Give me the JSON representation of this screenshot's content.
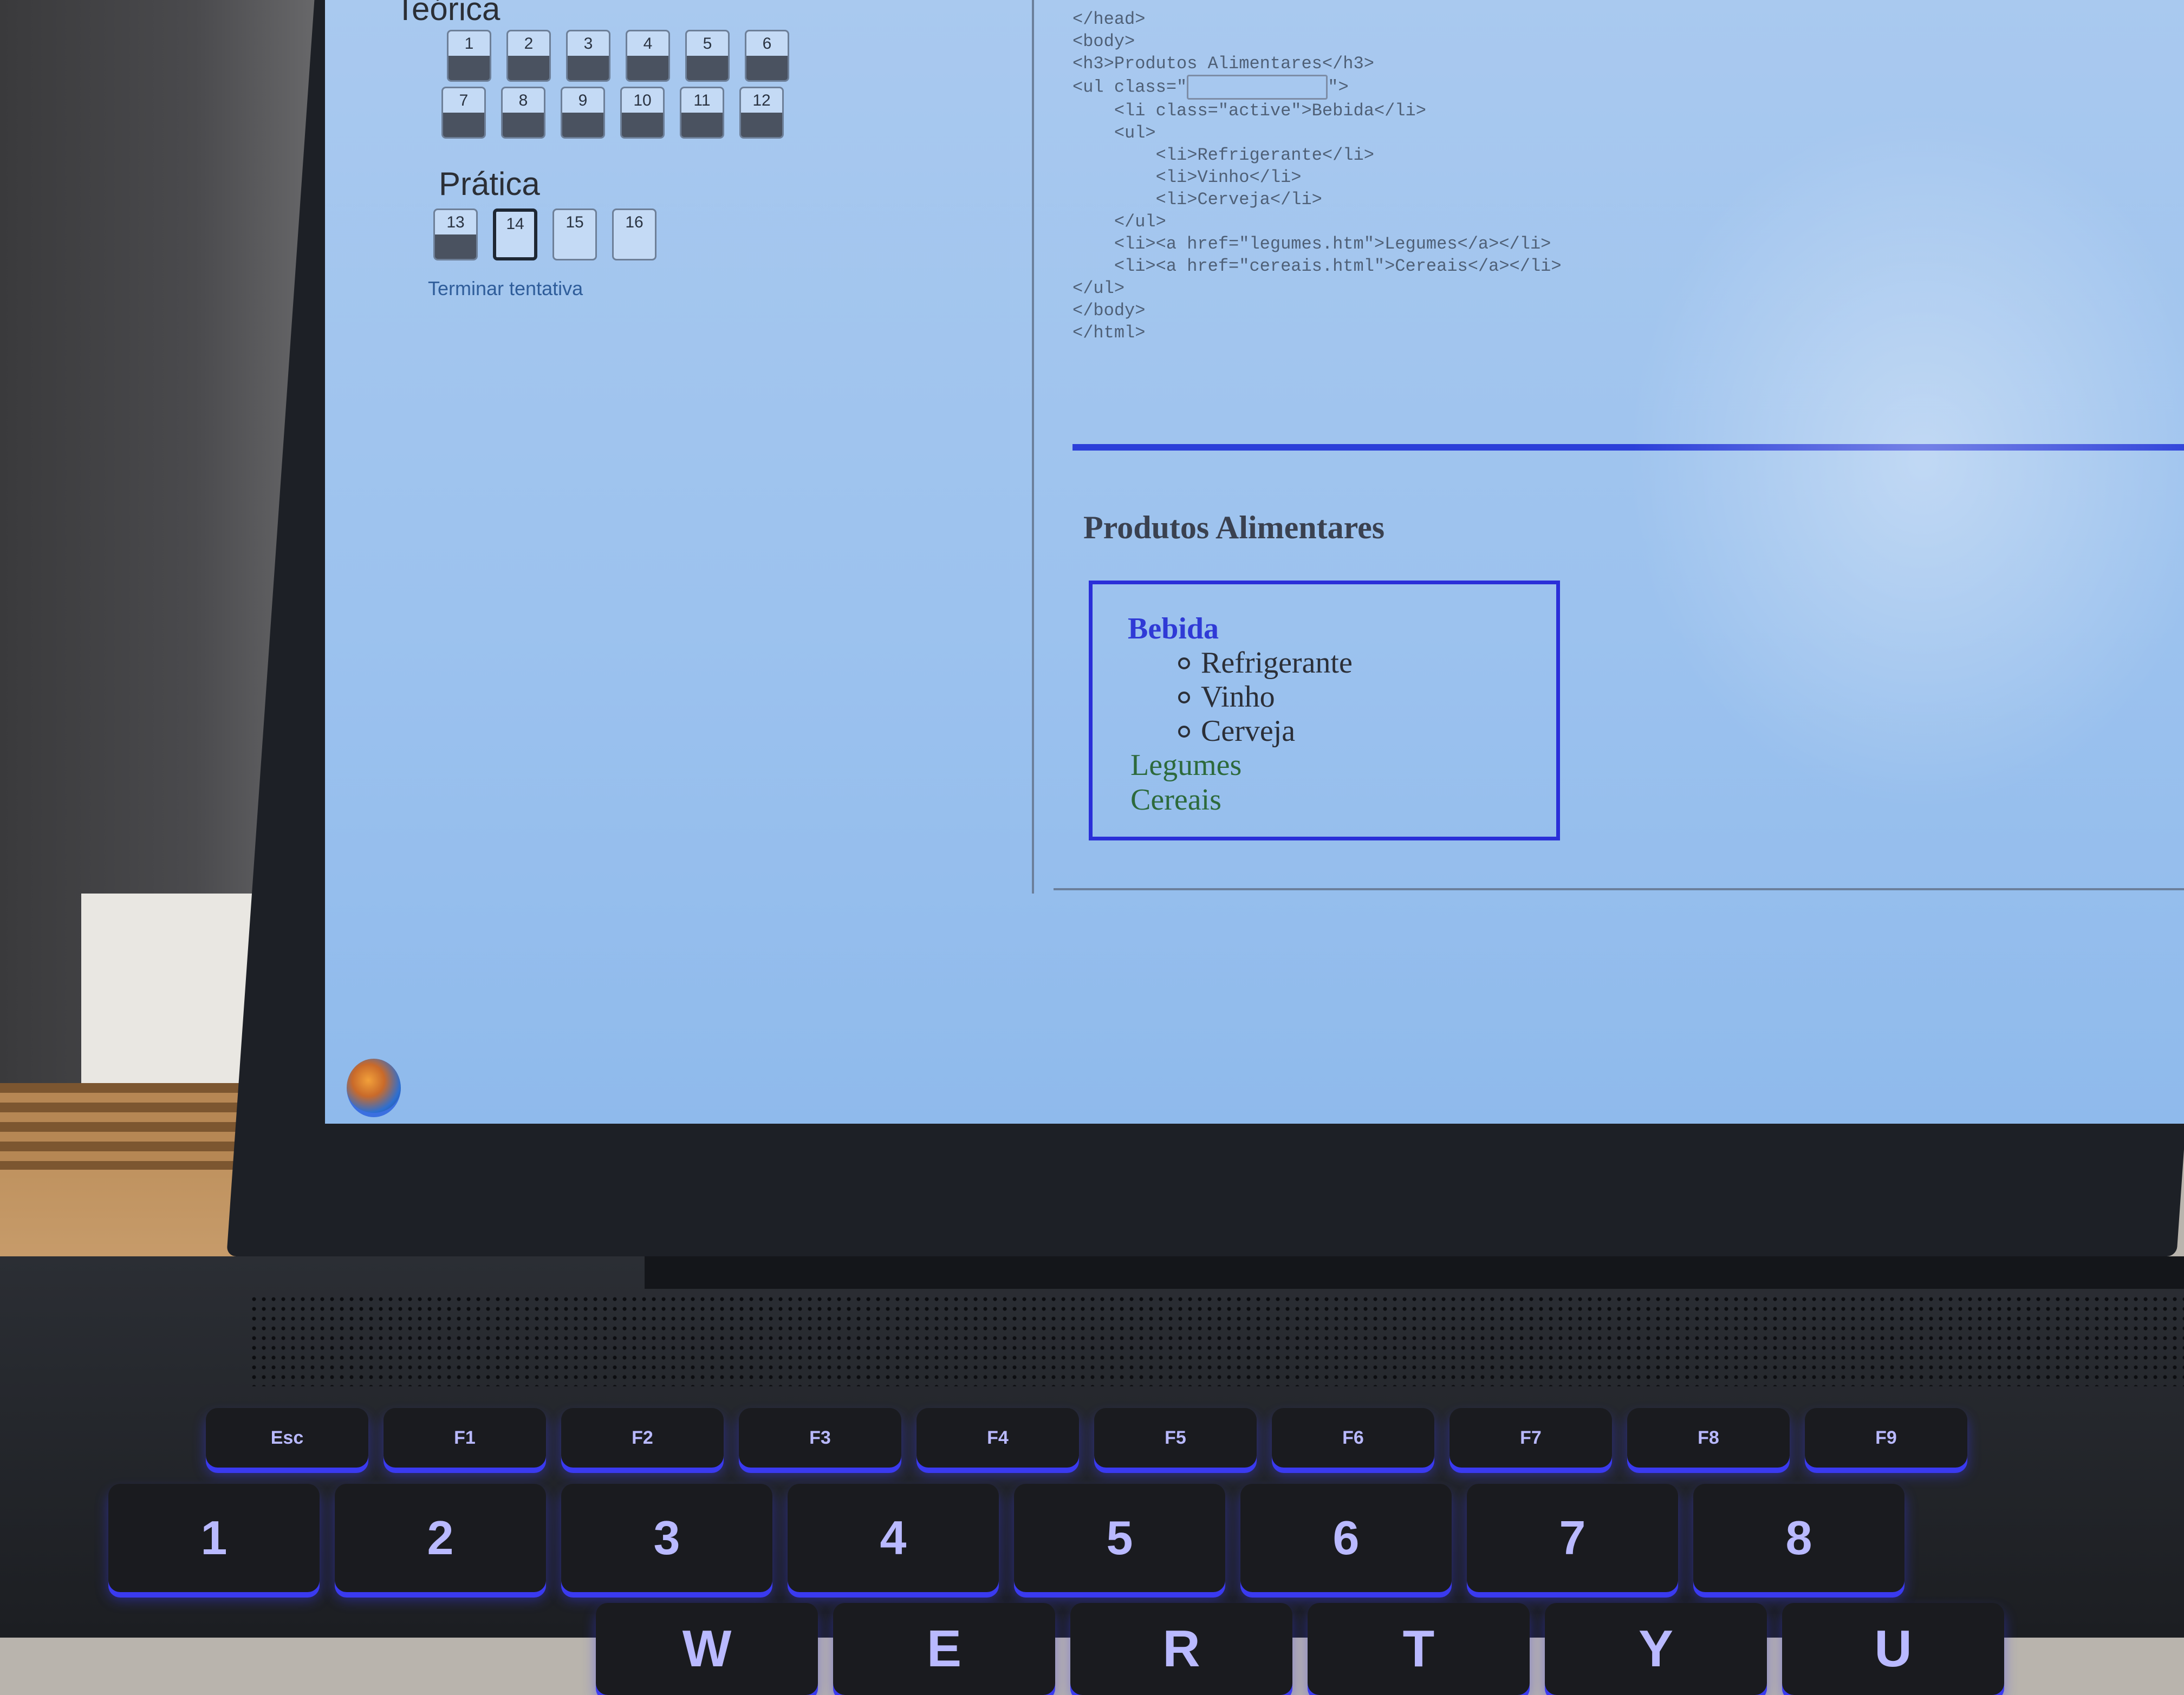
{
  "quiz_nav": {
    "teorica_label": "Teórica",
    "teorica_questions": [
      "1",
      "2",
      "3",
      "4",
      "5",
      "6",
      "7",
      "8",
      "9",
      "10",
      "11",
      "12"
    ],
    "pratica_label": "Prática",
    "pratica_questions": [
      "13",
      "14",
      "15",
      "16"
    ],
    "current_question": "14",
    "finish_label": "Terminar tentativa"
  },
  "code_listing": {
    "line_1": "</head>",
    "line_2": "<body>",
    "line_3": "<h3>Produtos Alimentares</h3>",
    "line_4_prefix": "<ul class=\"",
    "line_4_suffix": "\">",
    "line_5": "    <li class=\"active\">Bebida</li>",
    "line_6": "    <ul>",
    "line_7": "        <li>Refrigerante</li>",
    "line_8": "        <li>Vinho</li>",
    "line_9": "        <li>Cerveja</li>",
    "line_10": "    </ul>",
    "line_11": "    <li><a href=\"legumes.htm\">Legumes</a></li>",
    "line_12": "    <li><a href=\"cereais.html\">Cereais</a></li>",
    "line_13": "</ul>",
    "line_14": "</body>",
    "line_15": "</html>"
  },
  "class_answer_input": {
    "value": ""
  },
  "preview": {
    "title": "Produtos Alimentares",
    "active_item": "Bebida",
    "sub_items": [
      "Refrigerante",
      "Vinho",
      "Cerveja"
    ],
    "links": [
      "Legumes",
      "Cereais"
    ]
  },
  "keyboard": {
    "function_row": [
      "Esc",
      "F1",
      "F2",
      "F3",
      "F4",
      "F5",
      "F6",
      "F7",
      "F8",
      "F9"
    ],
    "number_row": [
      "1",
      "2",
      "3",
      "4",
      "5",
      "6",
      "7",
      "8"
    ],
    "alpha_row": [
      "W",
      "E",
      "R",
      "T",
      "Y",
      "U"
    ]
  },
  "colors": {
    "accent_blue": "#2a2fd8",
    "link_green": "#2d6a3c",
    "screen_bg": "#9cc2ee"
  }
}
